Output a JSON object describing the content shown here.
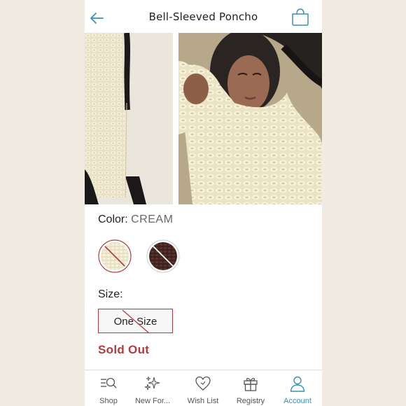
{
  "header": {
    "title": "Bell-Sleeved Poncho"
  },
  "product": {
    "color_label": "Color:",
    "color_value": "CREAM",
    "swatches": [
      {
        "name": "cream",
        "color": "#efe8cf",
        "unavailable": true,
        "selected": true
      },
      {
        "name": "dark",
        "color": "#4a2a26",
        "unavailable": true,
        "selected": false
      }
    ],
    "size_label": "Size:",
    "size_option": "One Size",
    "status": "Sold Out"
  },
  "colors": {
    "accent": "#3a8fb7",
    "sold_out": "#b03a3e"
  },
  "tabbar": {
    "items": [
      {
        "label": "Shop",
        "icon": "shop-search-icon"
      },
      {
        "label": "New For...",
        "icon": "sparkle-icon"
      },
      {
        "label": "Wish List",
        "icon": "heart-icon"
      },
      {
        "label": "Registry",
        "icon": "gift-icon"
      },
      {
        "label": "Account",
        "icon": "person-icon",
        "active": true
      }
    ]
  }
}
